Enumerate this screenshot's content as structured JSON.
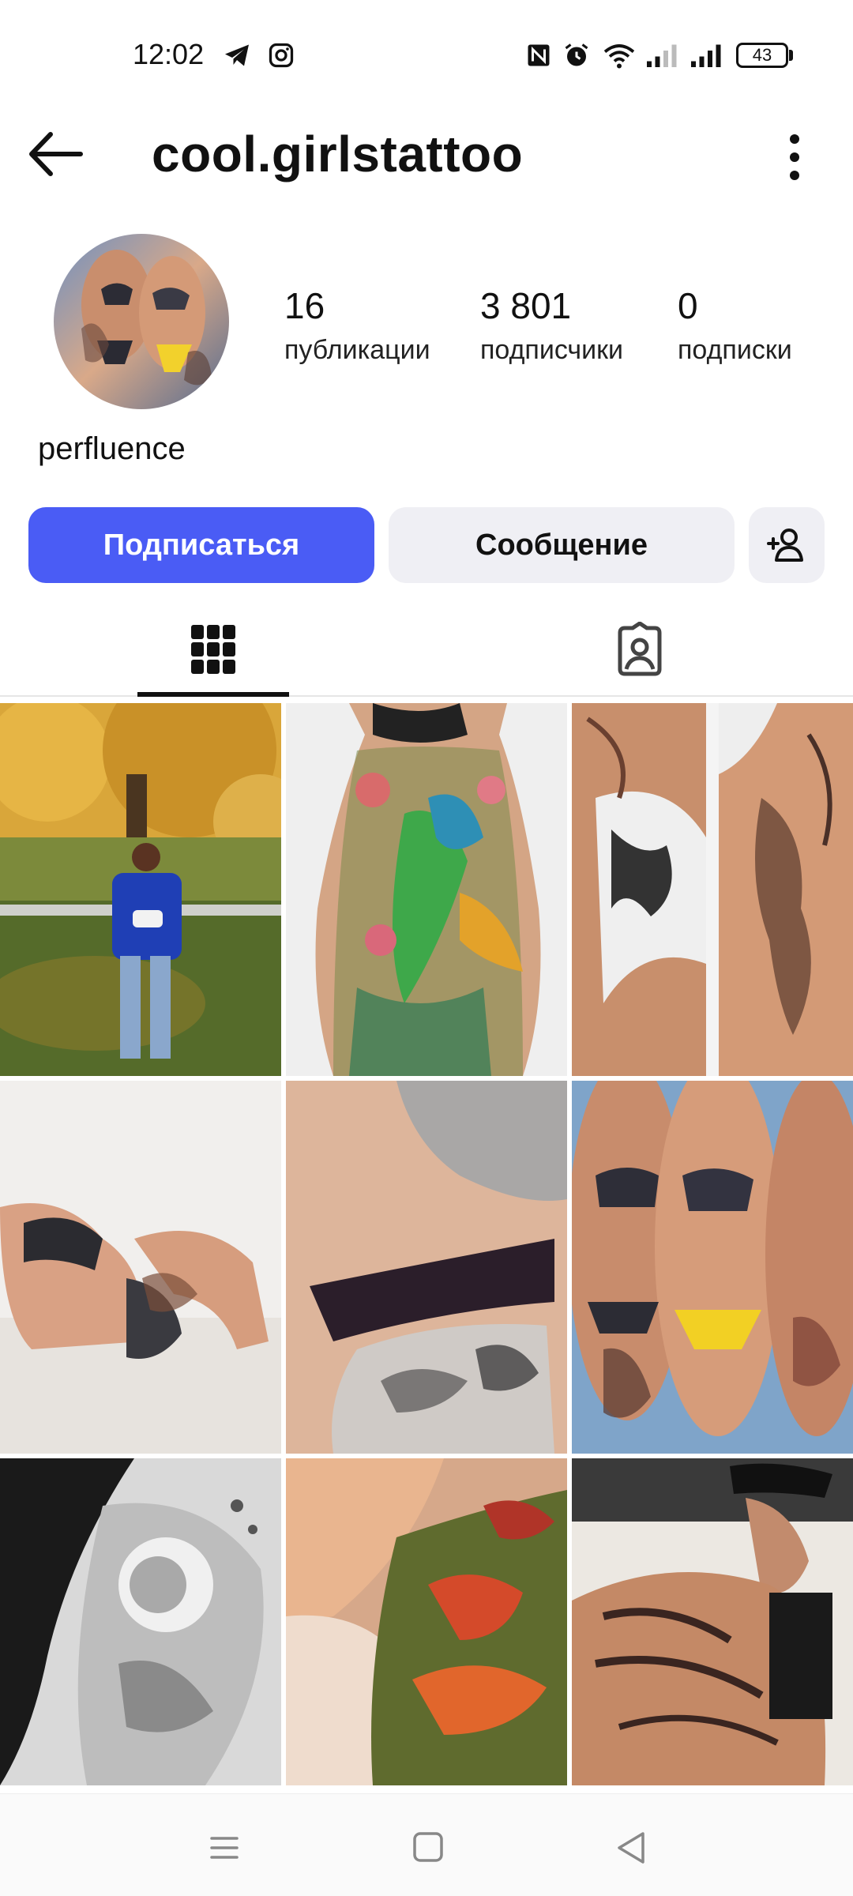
{
  "status_bar": {
    "time": "12:02",
    "battery": "43",
    "icons": [
      "telegram-icon",
      "instagram-icon",
      "nfc-icon",
      "alarm-icon",
      "wifi-icon",
      "signal-icon",
      "signal-icon",
      "battery-icon"
    ]
  },
  "header": {
    "username": "cool.girlstattoo",
    "back_icon": "arrow-left-icon",
    "more_icon": "more-vertical-icon"
  },
  "profile": {
    "display_name": "perfluence",
    "stats": [
      {
        "value": "16",
        "label": "публикации"
      },
      {
        "value": "3 801",
        "label": "подписчики"
      },
      {
        "value": "0",
        "label": "подписки"
      }
    ]
  },
  "actions": {
    "follow_label": "Подписаться",
    "message_label": "Сообщение",
    "add_user_icon": "person-add-icon",
    "accent": "#4a5cf5"
  },
  "tabs": [
    {
      "icon": "grid-icon",
      "active": true
    },
    {
      "icon": "tagged-person-icon",
      "active": false
    }
  ],
  "posts": {
    "count_visible": 9
  },
  "navbar": {
    "icons": [
      "menu-icon",
      "home-square-icon",
      "back-triangle-icon"
    ]
  }
}
